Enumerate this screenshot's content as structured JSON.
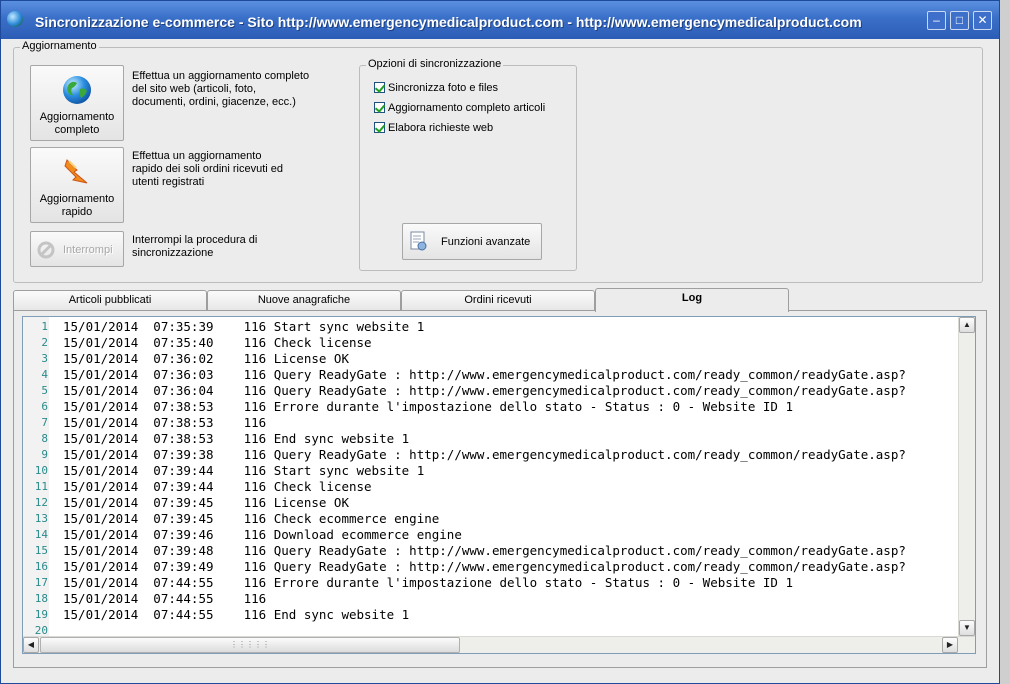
{
  "window": {
    "title": "Sincronizzazione e-commerce - Sito http://www.emergencymedicalproduct.com - http://www.emergencymedicalproduct.com",
    "minimize": "–",
    "maximize": "□",
    "close": "✕"
  },
  "update_group": {
    "label": "Aggiornamento",
    "full_update": {
      "label": "Aggiornamento completo",
      "description": "Effettua un aggiornamento completo\ndel sito web (articoli, foto,\ndocumenti, ordini, giacenze, ecc.)"
    },
    "quick_update": {
      "label": "Aggiornamento rapido",
      "description": "Effettua un aggiornamento\nrapido dei soli ordini ricevuti ed\nutenti registrati"
    },
    "interrupt": {
      "label": "Interrompi",
      "description": "Interrompi la procedura di\nsincronizzazione",
      "disabled": true
    }
  },
  "sync_options": {
    "label": "Opzioni di sincronizzazione",
    "items": [
      {
        "label": "Sincronizza foto e files",
        "checked": true
      },
      {
        "label": "Aggiornamento completo articoli",
        "checked": true
      },
      {
        "label": "Elabora richieste web",
        "checked": true
      }
    ],
    "advanced_button": "Funzioni avanzate"
  },
  "tabs": [
    {
      "label": "Articoli pubblicati",
      "active": false
    },
    {
      "label": "Nuove anagrafiche",
      "active": false
    },
    {
      "label": "Ordini ricevuti",
      "active": false
    },
    {
      "label": "Log",
      "active": true
    }
  ],
  "log": {
    "lines": [
      {
        "n": "1",
        "text": "15/01/2014  07:35:39    116 Start sync website 1"
      },
      {
        "n": "2",
        "text": "15/01/2014  07:35:40    116 Check license"
      },
      {
        "n": "3",
        "text": "15/01/2014  07:36:02    116 License OK"
      },
      {
        "n": "4",
        "text": "15/01/2014  07:36:03    116 Query ReadyGate : http://www.emergencymedicalproduct.com/ready_common/readyGate.asp?"
      },
      {
        "n": "5",
        "text": "15/01/2014  07:36:04    116 Query ReadyGate : http://www.emergencymedicalproduct.com/ready_common/readyGate.asp?"
      },
      {
        "n": "6",
        "text": "15/01/2014  07:38:53    116 Errore durante l'impostazione dello stato - Status : 0 - Website ID 1"
      },
      {
        "n": "7",
        "text": "15/01/2014  07:38:53    116"
      },
      {
        "n": "8",
        "text": "15/01/2014  07:38:53    116 End sync website 1"
      },
      {
        "n": "9",
        "text": "15/01/2014  07:39:38    116 Query ReadyGate : http://www.emergencymedicalproduct.com/ready_common/readyGate.asp?"
      },
      {
        "n": "10",
        "text": "15/01/2014  07:39:44    116 Start sync website 1"
      },
      {
        "n": "11",
        "text": "15/01/2014  07:39:44    116 Check license"
      },
      {
        "n": "12",
        "text": "15/01/2014  07:39:45    116 License OK"
      },
      {
        "n": "13",
        "text": "15/01/2014  07:39:45    116 Check ecommerce engine"
      },
      {
        "n": "14",
        "text": "15/01/2014  07:39:46    116 Download ecommerce engine"
      },
      {
        "n": "15",
        "text": "15/01/2014  07:39:48    116 Query ReadyGate : http://www.emergencymedicalproduct.com/ready_common/readyGate.asp?"
      },
      {
        "n": "16",
        "text": "15/01/2014  07:39:49    116 Query ReadyGate : http://www.emergencymedicalproduct.com/ready_common/readyGate.asp?"
      },
      {
        "n": "17",
        "text": "15/01/2014  07:44:55    116 Errore durante l'impostazione dello stato - Status : 0 - Website ID 1"
      },
      {
        "n": "18",
        "text": "15/01/2014  07:44:55    116"
      },
      {
        "n": "19",
        "text": "15/01/2014  07:44:55    116 End sync website 1"
      },
      {
        "n": "20",
        "text": ""
      }
    ]
  }
}
